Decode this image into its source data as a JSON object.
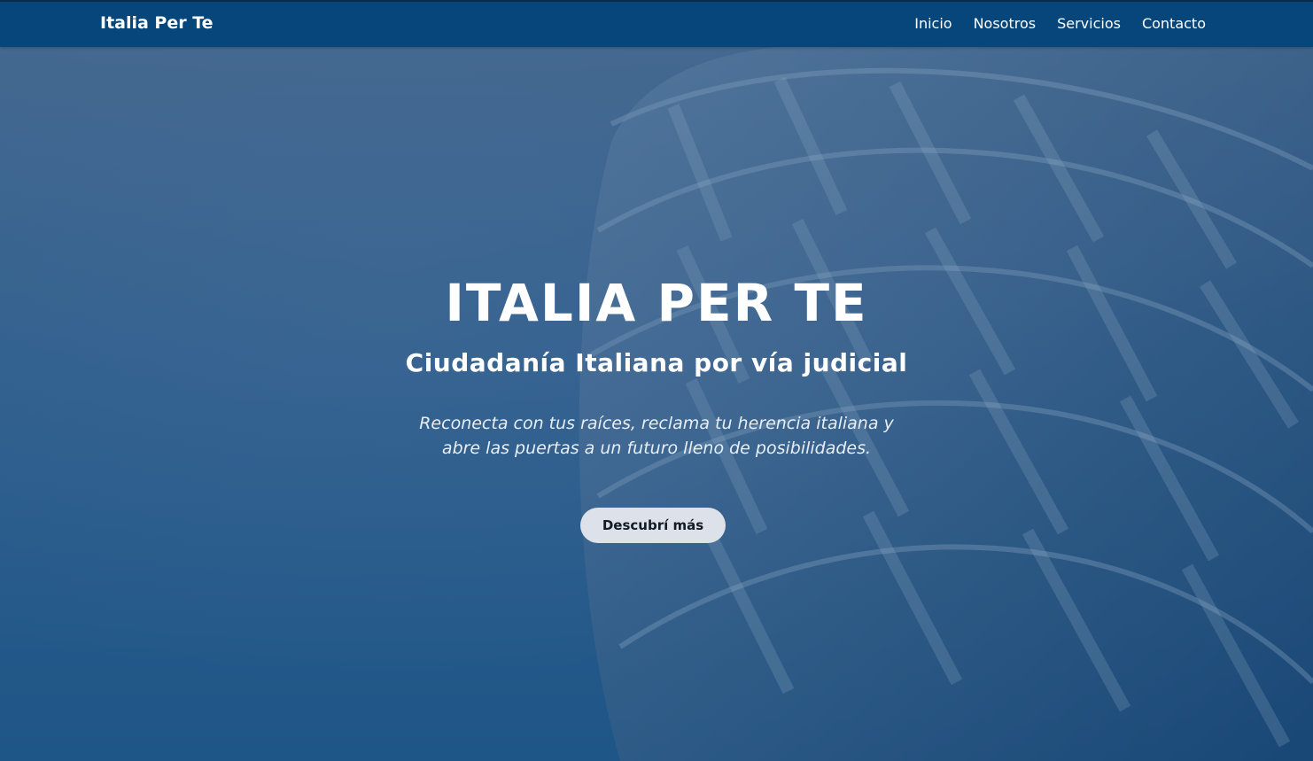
{
  "navbar": {
    "brand": "Italia Per Te",
    "links": [
      {
        "label": "Inicio"
      },
      {
        "label": "Nosotros"
      },
      {
        "label": "Servicios"
      },
      {
        "label": "Contacto"
      }
    ]
  },
  "hero": {
    "title": "ITALIA PER TE",
    "subtitle": "Ciudadanía Italiana por vía judicial",
    "description": "Reconecta con tus raíces, reclama tu herencia italiana y abre las puertas a un futuro lleno de posibilidades.",
    "cta_label": "Descubrí más"
  },
  "colors": {
    "navbar_background": "#06467a",
    "hero_background": "#2f5f8e",
    "button_background": "#dde2ea",
    "text": "#ffffff"
  }
}
